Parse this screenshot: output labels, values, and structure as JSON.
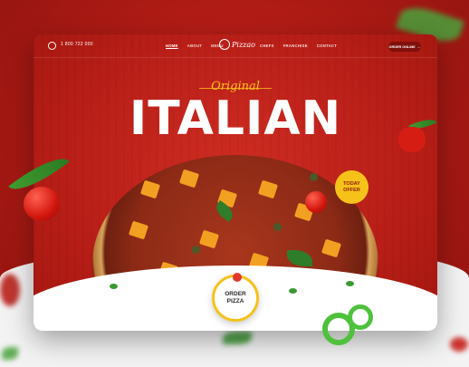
{
  "header": {
    "phone": "1 800 722 000",
    "menu_left": [
      "HOME",
      "ABOUT",
      "MENU"
    ],
    "logo_text": "Pizzao",
    "menu_right": [
      "CHEFS",
      "FRANCHISE",
      "CONTACT"
    ],
    "order_button": "ORDER ONLINE"
  },
  "hero": {
    "script_text": "Original",
    "title": "ITALIAN",
    "offer_badge": [
      "TODAY",
      "OFFER"
    ],
    "cta": [
      "ORDER",
      "PIZZA"
    ]
  },
  "colors": {
    "primary": "#c3231b",
    "accent": "#f6c21a",
    "white": "#ffffff"
  }
}
